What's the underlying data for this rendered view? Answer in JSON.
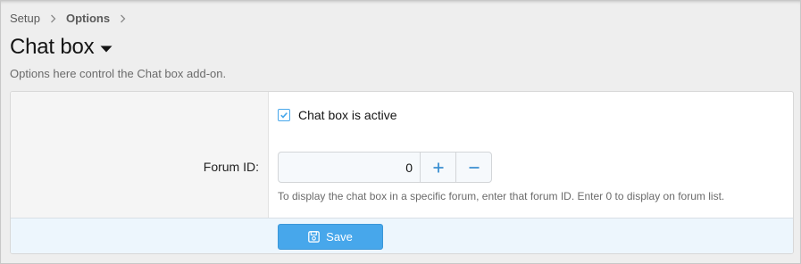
{
  "breadcrumb": {
    "items": [
      {
        "label": "Setup"
      },
      {
        "label": "Options"
      }
    ]
  },
  "page": {
    "title": "Chat box",
    "description": "Options here control the Chat box add-on."
  },
  "options": {
    "active_checkbox": {
      "label": "Chat box is active",
      "checked": true
    },
    "forum_id": {
      "label": "Forum ID:",
      "value": "0",
      "increment_icon": "plus-icon",
      "decrement_icon": "minus-icon",
      "hint": "To display the chat box in a specific forum, enter that forum ID. Enter 0 to display on forum list."
    }
  },
  "footer": {
    "save_label": "Save",
    "save_icon": "save-icon"
  },
  "colors": {
    "accent": "#47a7eb",
    "footer_bg": "#edf6fd",
    "label_col_bg": "#f5f5f5",
    "page_bg": "#eeeeee"
  }
}
